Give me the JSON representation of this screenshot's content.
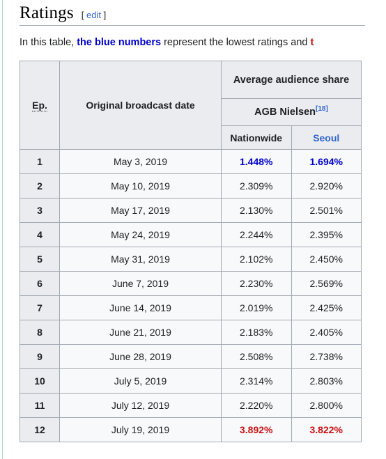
{
  "section": {
    "title": "Ratings",
    "edit_open_bracket": "[",
    "edit_label": "edit",
    "edit_close_bracket": "]"
  },
  "intro": {
    "part1": "In this table, ",
    "legend_low": "the blue numbers",
    "part2": " represent the lowest ratings and ",
    "legend_high_clipped": "t"
  },
  "table": {
    "headers": {
      "episode": "Ep.",
      "date": "Original broadcast date",
      "average_share": "Average audience share",
      "provider": "AGB Nielsen",
      "provider_ref": "[18]",
      "nationwide": "Nationwide",
      "seoul": "Seoul"
    },
    "rows": [
      {
        "ep": "1",
        "date": "May 3, 2019",
        "nationwide": "1.448%",
        "seoul": "1.694%",
        "style": "low"
      },
      {
        "ep": "2",
        "date": "May 10, 2019",
        "nationwide": "2.309%",
        "seoul": "2.920%",
        "style": ""
      },
      {
        "ep": "3",
        "date": "May 17, 2019",
        "nationwide": "2.130%",
        "seoul": "2.501%",
        "style": ""
      },
      {
        "ep": "4",
        "date": "May 24, 2019",
        "nationwide": "2.244%",
        "seoul": "2.395%",
        "style": ""
      },
      {
        "ep": "5",
        "date": "May 31, 2019",
        "nationwide": "2.102%",
        "seoul": "2.450%",
        "style": ""
      },
      {
        "ep": "6",
        "date": "June 7, 2019",
        "nationwide": "2.230%",
        "seoul": "2.569%",
        "style": ""
      },
      {
        "ep": "7",
        "date": "June 14, 2019",
        "nationwide": "2.019%",
        "seoul": "2.425%",
        "style": ""
      },
      {
        "ep": "8",
        "date": "June 21, 2019",
        "nationwide": "2.183%",
        "seoul": "2.405%",
        "style": ""
      },
      {
        "ep": "9",
        "date": "June 28, 2019",
        "nationwide": "2.508%",
        "seoul": "2.738%",
        "style": ""
      },
      {
        "ep": "10",
        "date": "July 5, 2019",
        "nationwide": "2.314%",
        "seoul": "2.803%",
        "style": ""
      },
      {
        "ep": "11",
        "date": "July 12, 2019",
        "nationwide": "2.220%",
        "seoul": "2.800%",
        "style": ""
      },
      {
        "ep": "12",
        "date": "July 19, 2019",
        "nationwide": "3.892%",
        "seoul": "3.822%",
        "style": "high"
      }
    ]
  },
  "colors": {
    "low": "#0000cc",
    "high": "#cc1111",
    "link": "#3366cc",
    "table_border": "#a2a9b1",
    "header_bg": "#eaecf0",
    "cell_bg": "#f8f9fa"
  }
}
